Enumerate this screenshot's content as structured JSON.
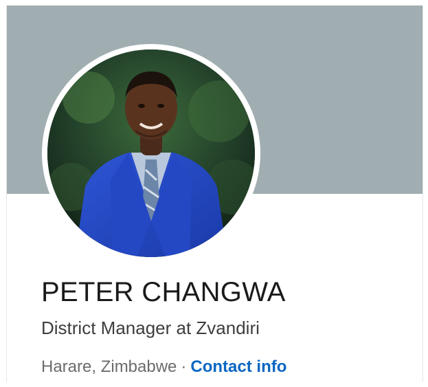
{
  "profile": {
    "name": "PETER CHANGWA",
    "headline": "District Manager at Zvandiri",
    "location": "Harare, Zimbabwe",
    "separator": "·",
    "contact_label": "Contact info"
  },
  "colors": {
    "banner": "#a1aeb1",
    "link": "#0a66c2",
    "name_text": "#1a1a1a",
    "headline_text": "#3d3d3d",
    "meta_text": "#6b6b6b"
  }
}
